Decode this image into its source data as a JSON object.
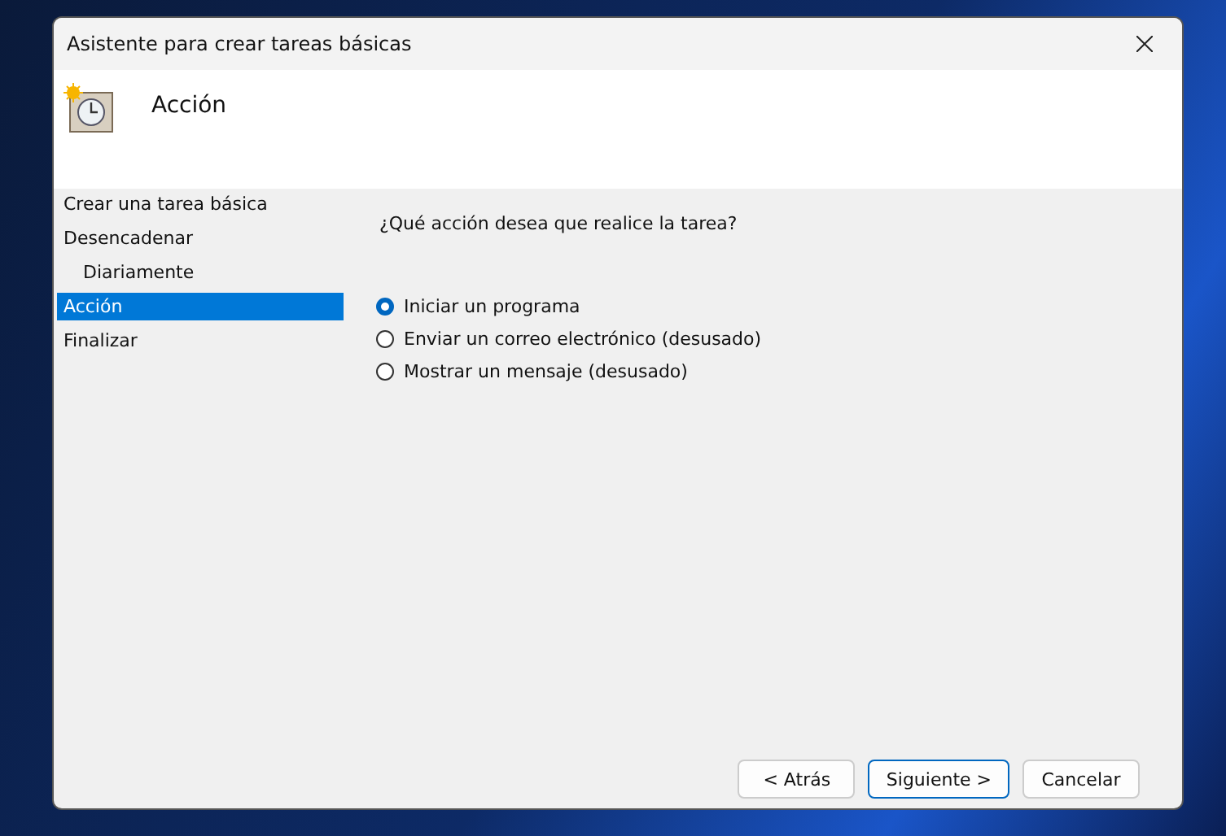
{
  "window": {
    "title": "Asistente para crear tareas básicas"
  },
  "header": {
    "title": "Acción"
  },
  "steps": [
    {
      "label": "Crear una tarea básica",
      "selected": false
    },
    {
      "label": "Desencadenar",
      "selected": false,
      "children": [
        {
          "label": "Diariamente",
          "selected": false
        }
      ]
    },
    {
      "label": "Acción",
      "selected": true
    },
    {
      "label": "Finalizar",
      "selected": false
    }
  ],
  "question": "¿Qué acción desea que realice la tarea?",
  "options": [
    {
      "label": "Iniciar un programa",
      "selected": true
    },
    {
      "label": "Enviar un correo electrónico (desusado)",
      "selected": false
    },
    {
      "label": "Mostrar un mensaje (desusado)",
      "selected": false
    }
  ],
  "buttons": [
    {
      "label": "< Atrás",
      "kind": "normal"
    },
    {
      "label": "Siguiente >",
      "kind": "default"
    },
    {
      "label": "Cancelar",
      "kind": "normal"
    }
  ]
}
